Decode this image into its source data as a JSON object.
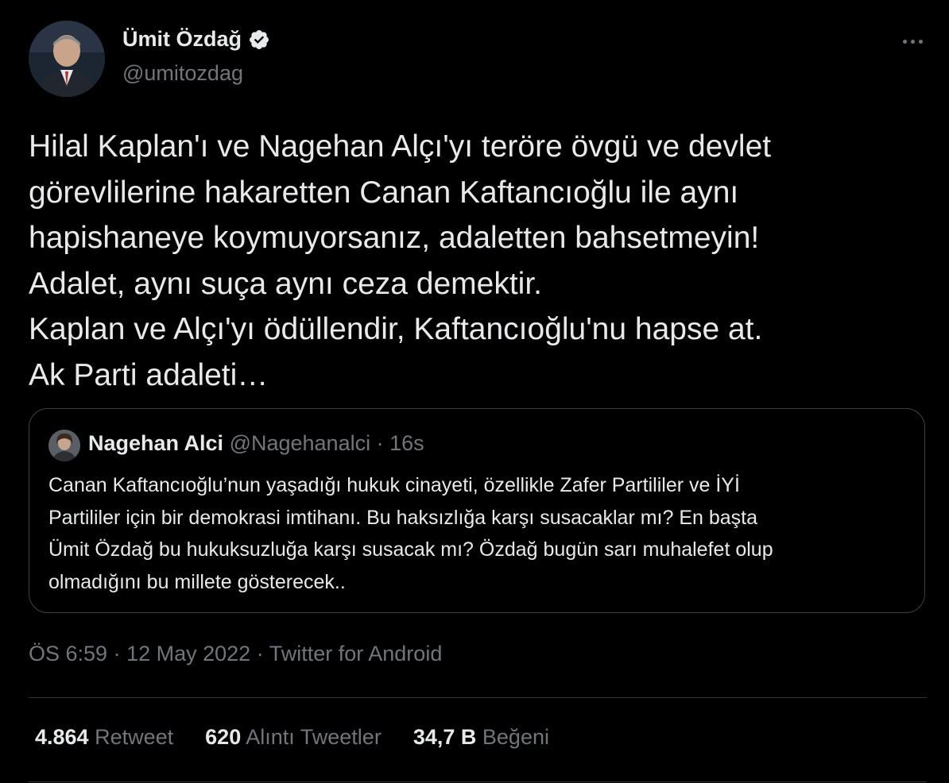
{
  "author": {
    "name": "Ümit Özdağ",
    "handle": "@umitozdag",
    "verified": true
  },
  "tweet": {
    "lines": [
      "Hilal Kaplan'ı ve Nagehan Alçı'yı teröre övgü ve devlet",
      "görevlilerine hakaretten Canan Kaftancıoğlu ile aynı",
      "hapishaneye koymuyorsanız, adaletten bahsetmeyin!",
      "Adalet, aynı suça aynı ceza demektir.",
      "Kaplan ve Alçı'yı ödüllendir, Kaftancıoğlu'nu hapse at.",
      "Ak Parti adaleti…"
    ]
  },
  "quote": {
    "name": "Nagehan Alci",
    "handle": "@Nagehanalci",
    "separator": "·",
    "time": "16s",
    "lines": [
      "Canan Kaftancıoğlu’nun yaşadığı hukuk cinayeti, özellikle Zafer Partililer ve İYİ",
      "Partililer için bir demokrasi imtihanı. Bu haksızlığa karşı susacaklar mı? En başta",
      "Ümit Özdağ bu hukuksuzluğa karşı susacak mı? Özdağ bugün sarı muhalefet olup",
      "olmadığını bu millete gösterecek.."
    ]
  },
  "meta": {
    "time": "ÖS 6:59",
    "separator": "·",
    "date": "12 May 2022",
    "source": "Twitter for Android"
  },
  "stats": {
    "retweets": {
      "count": "4.864",
      "label": "Retweet"
    },
    "quotes": {
      "count": "620",
      "label": "Alıntı Tweetler"
    },
    "likes": {
      "count": "34,7 B",
      "label": "Beğeni"
    }
  },
  "colors": {
    "background": "#000000",
    "text": "#e7e9ea",
    "secondary": "#71767b",
    "border": "#2f3336"
  },
  "icons": {
    "verified": "verified-badge-icon",
    "more": "more-horizontal-icon"
  }
}
